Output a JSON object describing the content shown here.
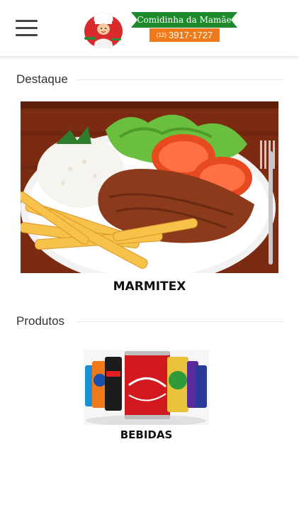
{
  "header": {
    "brand_name": "Comidinha da Mamãe",
    "phone_ddd": "(12)",
    "phone_number": "3917-1727",
    "icons": {
      "menu": "hamburger-menu-icon",
      "logo": "chef-mascot-logo"
    }
  },
  "sections": {
    "featured": {
      "title": "Destaque",
      "item_label": "MARMITEX"
    },
    "products": {
      "title": "Produtos",
      "item_label": "BEBIDAS"
    }
  },
  "colors": {
    "ribbon_green": "#1d8a2c",
    "phone_orange": "#f07a1a",
    "background": "#ffffff"
  }
}
